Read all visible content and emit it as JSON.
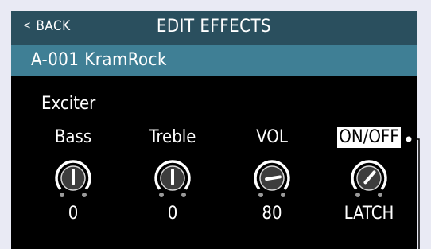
{
  "header": {
    "back_chevron": "<",
    "back_label": "BACK",
    "title": "EDIT EFFECTS"
  },
  "patch": {
    "name": "A-001 KramRock"
  },
  "effect": {
    "name": "Exciter"
  },
  "params": [
    {
      "label": "Bass",
      "value": "0",
      "level": 0.5,
      "highlighted": false
    },
    {
      "label": "Treble",
      "value": "0",
      "level": 0.5,
      "highlighted": false
    },
    {
      "label": "VOL",
      "value": "80",
      "level": 0.8,
      "highlighted": false
    },
    {
      "label": "ON/OFF",
      "value": "LATCH",
      "level": 0.65,
      "highlighted": true
    }
  ],
  "colors": {
    "header_bg": "#2a4f5e",
    "patch_bg": "#3f7f95",
    "screen_bg": "#000000",
    "page_bg": "#e9eaf4"
  }
}
